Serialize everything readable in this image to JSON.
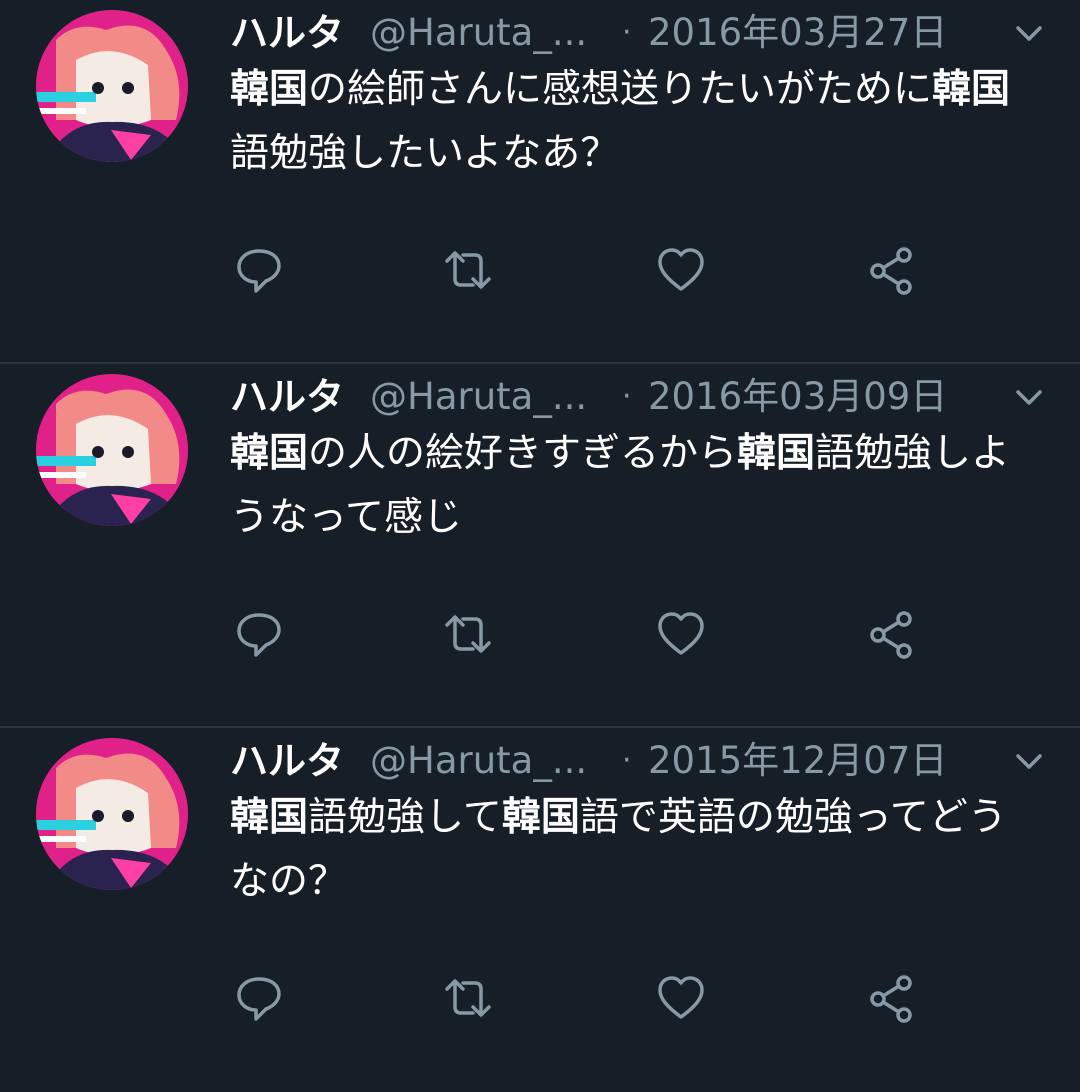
{
  "colors": {
    "background": "#161e27",
    "divider": "#2c3640",
    "text_primary": "#ffffff",
    "text_secondary": "#8899a6",
    "icon": "#8899a6"
  },
  "icons": {
    "reply": "reply-icon",
    "retweet": "retweet-icon",
    "like": "heart-icon",
    "share": "share-icon",
    "more": "chevron-down-icon"
  },
  "tweets": [
    {
      "display_name": "ハルタ",
      "handle": "@Haruta_...",
      "separator": "·",
      "date": "2016年03月27日",
      "text_segments": [
        {
          "text": "韓国",
          "bold": true
        },
        {
          "text": "の絵師さんに感想送りたいがために",
          "bold": false
        },
        {
          "text": "韓国",
          "bold": true
        },
        {
          "text": "語勉強したいよなあ？",
          "bold": false
        }
      ]
    },
    {
      "display_name": "ハルタ",
      "handle": "@Haruta_...",
      "separator": "·",
      "date": "2016年03月09日",
      "text_segments": [
        {
          "text": "韓国",
          "bold": true
        },
        {
          "text": "の人の絵好きすぎるから",
          "bold": false
        },
        {
          "text": "韓国",
          "bold": true
        },
        {
          "text": "語勉強しようなって感じ",
          "bold": false
        }
      ]
    },
    {
      "display_name": "ハルタ",
      "handle": "@Haruta_...",
      "separator": "·",
      "date": "2015年12月07日",
      "text_segments": [
        {
          "text": "韓国",
          "bold": true
        },
        {
          "text": "語勉強して",
          "bold": false
        },
        {
          "text": "韓国",
          "bold": true
        },
        {
          "text": "語で英語の勉強ってどうなの？",
          "bold": false
        }
      ]
    }
  ]
}
